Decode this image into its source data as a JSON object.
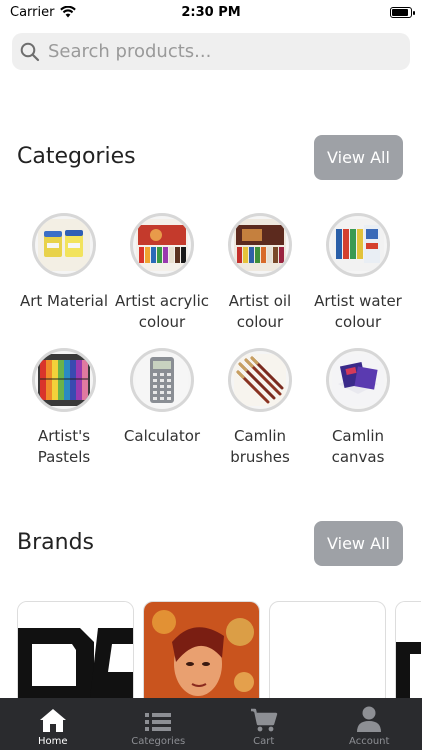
{
  "status_bar": {
    "carrier": "Carrier",
    "time": "2:30 PM"
  },
  "search": {
    "placeholder": "Search products..."
  },
  "categories": {
    "title": "Categories",
    "view_all": "View All",
    "items": [
      {
        "label": "Art Material",
        "icon": "art-material-image"
      },
      {
        "label": "Artist acrylic colour",
        "icon": "acrylic-tubes-image"
      },
      {
        "label": "Artist oil colour",
        "icon": "oil-tubes-image"
      },
      {
        "label": "Artist water colour",
        "icon": "watercolour-tubes-image"
      },
      {
        "label": "Artist's Pastels",
        "icon": "pastels-image"
      },
      {
        "label": "Calculator",
        "icon": "calculator-image"
      },
      {
        "label": "Camlin brushes",
        "icon": "brushes-image"
      },
      {
        "label": "Camlin canvas",
        "icon": "canvas-image"
      }
    ]
  },
  "brands": {
    "title": "Brands",
    "view_all": "View All",
    "items": [
      {
        "name": "brand-logo-d"
      },
      {
        "name": "brand-painting"
      },
      {
        "name": "brand-blank"
      },
      {
        "name": "brand-partial"
      }
    ]
  },
  "tab_bar": {
    "items": [
      {
        "label": "Home",
        "icon": "home-icon",
        "active": true
      },
      {
        "label": "Categories",
        "icon": "list-icon",
        "active": false
      },
      {
        "label": "Cart",
        "icon": "cart-icon",
        "active": false
      },
      {
        "label": "Account",
        "icon": "user-icon",
        "active": false
      }
    ]
  },
  "colors": {
    "button_bg": "#9ea1a6",
    "tab_bar_bg": "#2a2b2e",
    "search_bg": "#efefef"
  }
}
